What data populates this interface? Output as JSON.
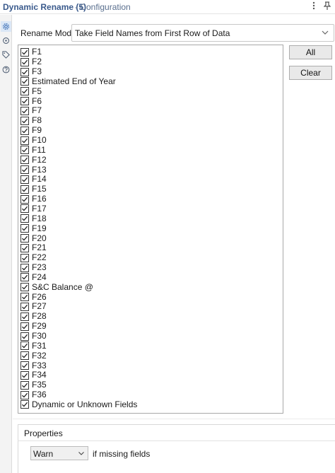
{
  "window": {
    "title": "Dynamic Rename (5)",
    "subtitle": "- Configuration"
  },
  "sidebar": {
    "icons": [
      "gear-icon",
      "circular-arrows-icon",
      "tag-icon",
      "help-icon"
    ]
  },
  "rename_mode": {
    "label": "Rename Mode:",
    "value": "Take Field Names from First Row of Data"
  },
  "fields": [
    "F1",
    "F2",
    "F3",
    "Estimated End of Year",
    "F5",
    "F6",
    "F7",
    "F8",
    "F9",
    "F10",
    "F11",
    "F12",
    "F13",
    "F14",
    "F15",
    "F16",
    "F17",
    "F18",
    "F19",
    "F20",
    "F21",
    "F22",
    "F23",
    "F24",
    "S&C Balance @",
    "F26",
    "F27",
    "F28",
    "F29",
    "F30",
    "F31",
    "F32",
    "F33",
    "F34",
    "F35",
    "F36",
    "Dynamic or Unknown Fields"
  ],
  "buttons": {
    "all": "All",
    "clear": "Clear"
  },
  "properties": {
    "title": "Properties",
    "missing_action": "Warn",
    "missing_label": "if missing fields"
  }
}
